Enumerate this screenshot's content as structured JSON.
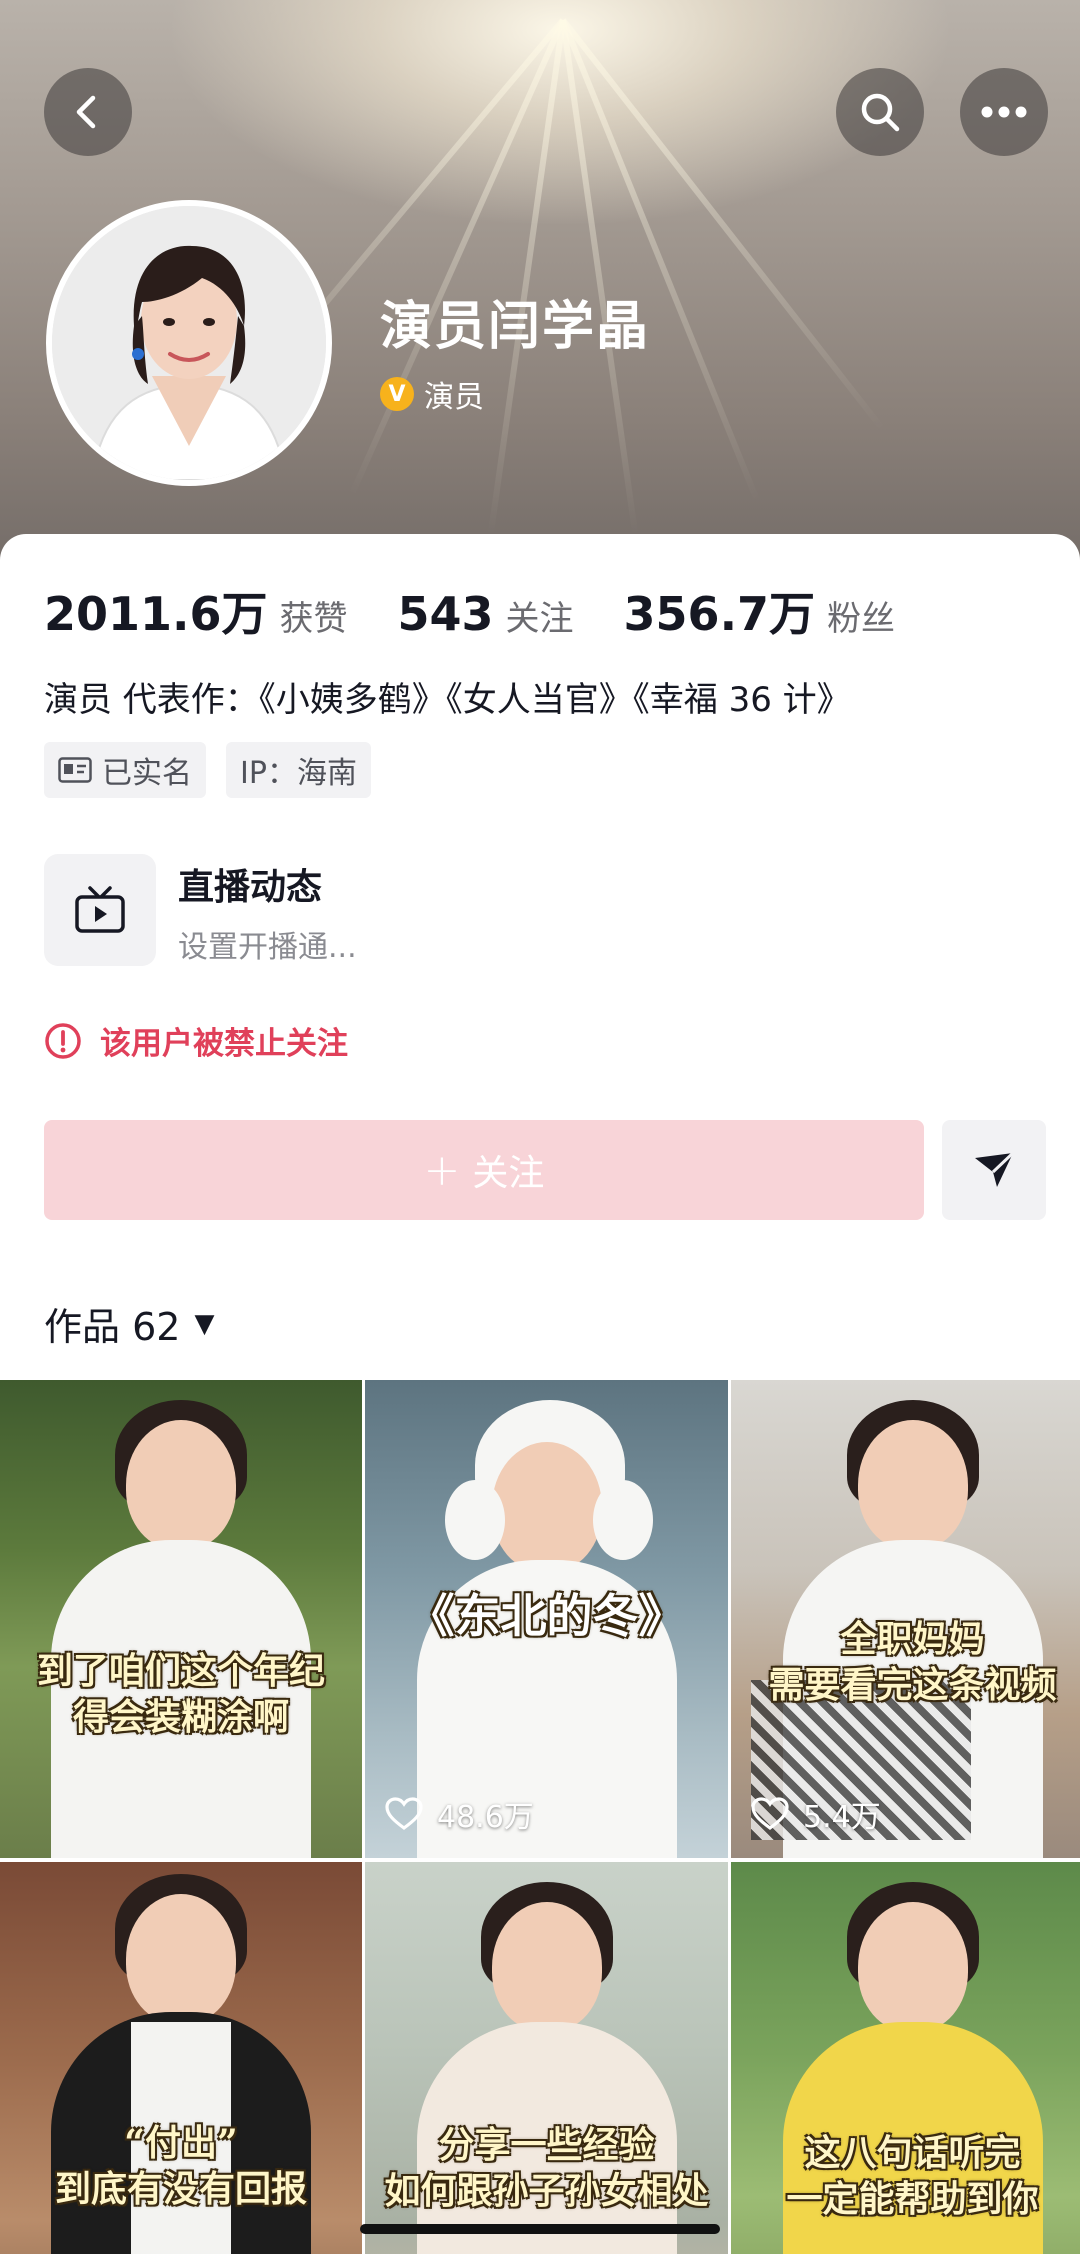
{
  "header": {
    "name": "演员闫学晶",
    "verify_label": "演员",
    "verify_badge": "V"
  },
  "stats": [
    {
      "value": "2011.6万",
      "label": "获赞"
    },
    {
      "value": "543",
      "label": "关注"
    },
    {
      "value": "356.7万",
      "label": "粉丝"
    }
  ],
  "bio": "演员 代表作：《小姨多鹤》《女人当官》《幸福 36 计》",
  "tags": {
    "verified": "已实名",
    "ip": "IP：海南"
  },
  "live": {
    "title": "直播动态",
    "subtitle": "设置开播通..."
  },
  "ban_notice": "该用户被禁止关注",
  "follow_label": "关注",
  "follow_plus": "+",
  "works": {
    "label": "作品 62",
    "caret": "▼"
  },
  "videos": [
    {
      "caption_lines": [
        "到了咱们这个年纪",
        "得会装糊涂啊"
      ],
      "likes": ""
    },
    {
      "caption_lines": [
        "《东北的冬》"
      ],
      "likes": "48.6万"
    },
    {
      "caption_lines": [
        "全职妈妈",
        "需要看完这条视频"
      ],
      "likes": "5.4万"
    },
    {
      "caption_lines": [
        "“付出”",
        "到底有没有回报"
      ],
      "likes": ""
    },
    {
      "caption_lines": [
        "分享一些经验",
        "如何跟孙子孙女相处"
      ],
      "likes": ""
    },
    {
      "caption_lines": [
        "这八句话听完",
        "一定能帮助到你"
      ],
      "likes": ""
    }
  ],
  "colors": {
    "ban_red": "#e0405a",
    "follow_bg": "#f8d4d8",
    "verify_gold": "#f7b21c"
  }
}
